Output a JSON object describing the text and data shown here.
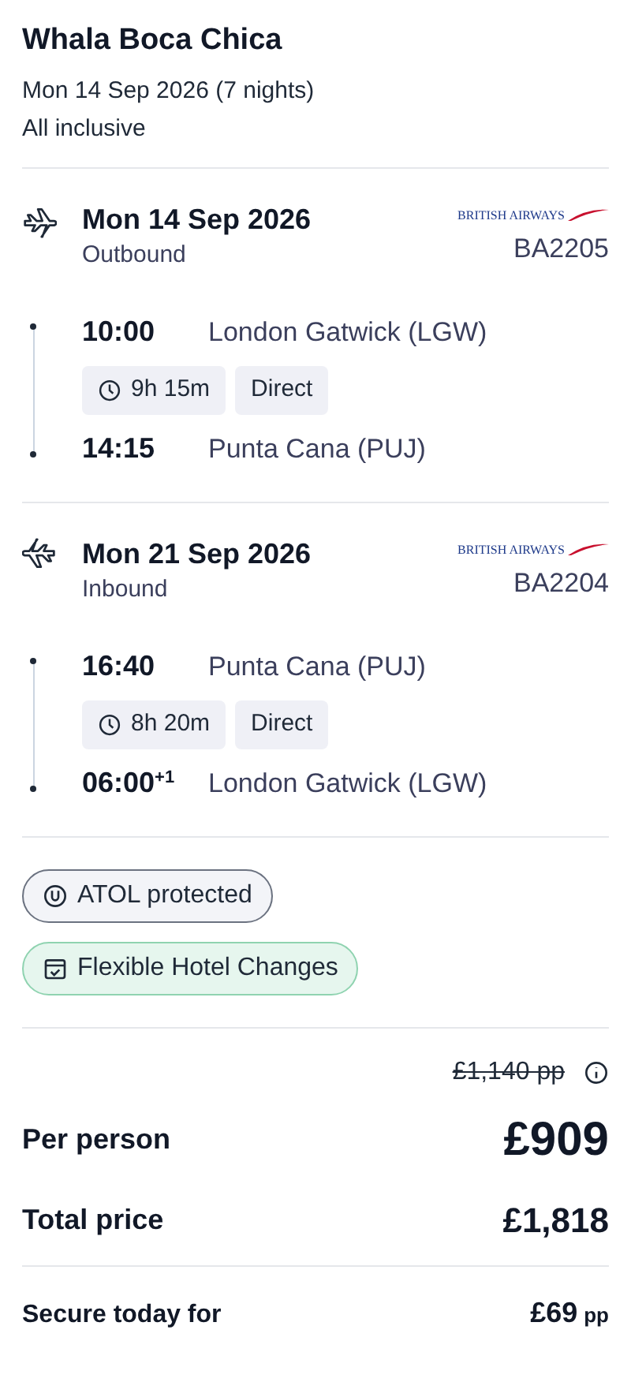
{
  "hotel": {
    "name": "Whala Boca Chica",
    "dates": "Mon 14 Sep 2026 (7 nights)",
    "board": "All inclusive"
  },
  "flights": [
    {
      "kind": "outbound",
      "date": "Mon 14 Sep 2026",
      "direction": "Outbound",
      "airline": "BRITISH AIRWAYS",
      "flight_number": "BA2205",
      "depart": {
        "time": "10:00",
        "airport": "London Gatwick (LGW)"
      },
      "duration": "9h 15m",
      "stops": "Direct",
      "arrive": {
        "time": "14:15",
        "airport": "Punta Cana (PUJ)"
      }
    },
    {
      "kind": "inbound",
      "date": "Mon 21 Sep 2026",
      "direction": "Inbound",
      "airline": "BRITISH AIRWAYS",
      "flight_number": "BA2204",
      "depart": {
        "time": "16:40",
        "airport": "Punta Cana (PUJ)"
      },
      "duration": "8h 20m",
      "stops": "Direct",
      "arrive": {
        "time": "06:00$^{+1}$",
        "airport": "London Gatwick (LGW)"
      }
    }
  ],
  "badges": [
    {
      "kind": "atol",
      "label": "ATOL protected"
    },
    {
      "kind": "flexible",
      "label": "Flexible Hotel Changes"
    }
  ],
  "price": {
    "was": "£1,140 pp",
    "per_person_label": "Per person",
    "per_person": "£909",
    "total_label": "Total price",
    "total": "£1,818",
    "secure_label": "Secure today for",
    "secure_amount": "£69",
    "secure_unit": "pp"
  }
}
